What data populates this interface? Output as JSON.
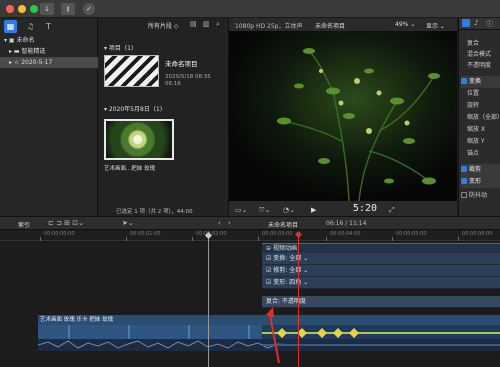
{
  "library": {
    "name": "未命名",
    "smart_collections": "智能精选",
    "event": "2020-5-17"
  },
  "browser": {
    "clip_filter": "所有片段",
    "projects_header": "项目",
    "projects_count": "(1)",
    "project_title": "未命名项目",
    "project_date": "2020/5/18 08:35",
    "project_duration": "06:16",
    "date_header": "2020年5月8日",
    "date_count": "(1)",
    "clip_label": "艺术画面...把妹 玫瑰",
    "status": "已选定 1 项（共 2 项），44:00"
  },
  "viewer": {
    "format": "1080p HD 25p，立体声",
    "title": "未命名项目",
    "zoom": "49%",
    "view_menu": "显示",
    "timecode": "5:20"
  },
  "inspector": {
    "items": [
      {
        "label": "复合",
        "checked": null
      },
      {
        "label": "混合模式",
        "checked": null
      },
      {
        "label": "不透明度",
        "checked": null
      },
      {
        "label": "变换",
        "checked": true
      },
      {
        "label": "位置",
        "checked": null
      },
      {
        "label": "旋转",
        "checked": null
      },
      {
        "label": "缩放（全部）",
        "checked": null
      },
      {
        "label": "缩放 X",
        "checked": null
      },
      {
        "label": "缩放 Y",
        "checked": null
      },
      {
        "label": "锚点",
        "checked": null
      },
      {
        "label": "裁剪",
        "checked": true
      },
      {
        "label": "变形",
        "checked": true
      },
      {
        "label": "防抖动",
        "checked": false
      }
    ]
  },
  "timeline": {
    "index_label": "索引",
    "project_name": "未命名项目",
    "project_time": "06:16 / 11:14",
    "ruler": [
      "00:00:00:00",
      "00:00:01:00",
      "00:00:02:00",
      "00:00:03:00",
      "00:00:04:00",
      "00:00:05:00",
      "00:00:06:00"
    ],
    "anim_title": "视频动画",
    "fx_rows": [
      "变换: 全部",
      "修剪: 全部",
      "变形: 四角",
      "复合: 不透明度"
    ],
    "clip_name": "艺术画面 玫瑰 乐卡 把妹 玫瑰"
  },
  "colors": {
    "accent": "#2f7de1",
    "playhead": "#e0302a",
    "clip_blue": "#2c4d72",
    "keyframe": "#e7d34a"
  }
}
